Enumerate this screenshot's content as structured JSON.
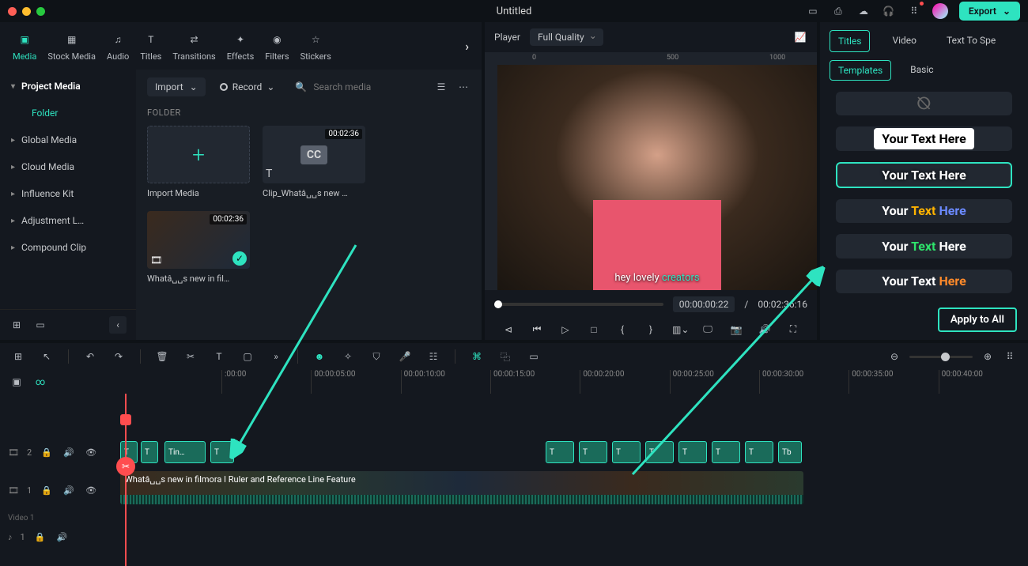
{
  "title": "Untitled",
  "export_label": "Export",
  "nav": {
    "items": [
      {
        "id": "media",
        "label": "Media"
      },
      {
        "id": "stock",
        "label": "Stock Media"
      },
      {
        "id": "audio",
        "label": "Audio"
      },
      {
        "id": "titles",
        "label": "Titles"
      },
      {
        "id": "transitions",
        "label": "Transitions"
      },
      {
        "id": "effects",
        "label": "Effects"
      },
      {
        "id": "filters",
        "label": "Filters"
      },
      {
        "id": "stickers",
        "label": "Stickers"
      }
    ]
  },
  "sidebar": {
    "project": "Project Media",
    "folder": "Folder",
    "items": [
      "Global Media",
      "Cloud Media",
      "Influence Kit",
      "Adjustment L…",
      "Compound Clip"
    ]
  },
  "mediabar": {
    "import": "Import",
    "record": "Record",
    "search_placeholder": "Search media",
    "folder_label": "FOLDER"
  },
  "media": {
    "import_label": "Import Media",
    "clip_cc_name": "Clip_Whatâ␣␣s new …",
    "clip_cc_dur": "00:02:36",
    "clip_vid_name": "Whatâ␣␣s new in fil…",
    "clip_vid_dur": "00:02:36"
  },
  "player": {
    "label": "Player",
    "quality": "Full Quality",
    "caption_a": "hey lovely",
    "caption_b": "creators",
    "time_current": "00:00:00:22",
    "time_sep": "/",
    "time_total": "00:02:36:16"
  },
  "right": {
    "tabs": [
      "Titles",
      "Video",
      "Text To Spe"
    ],
    "subtabs": [
      "Templates",
      "Basic"
    ],
    "tpl_text": "Your Text Here",
    "apply": "Apply to All"
  },
  "timeline": {
    "marks": [
      ":00:00",
      "00:00:05:00",
      "00:00:10:00",
      "00:00:15:00",
      "00:00:20:00",
      "00:00:25:00",
      "00:00:30:00",
      "00:00:35:00",
      "00:00:40:00"
    ],
    "track2_badge": "2",
    "track1_badge": "1",
    "video_label": "Video 1",
    "audio_badge": "1",
    "text_clip_label": "in…",
    "text_clip_b": "b",
    "video_clip_title": "Whatâ␣␣s new in filmora I Ruler and Reference Line Feature"
  }
}
